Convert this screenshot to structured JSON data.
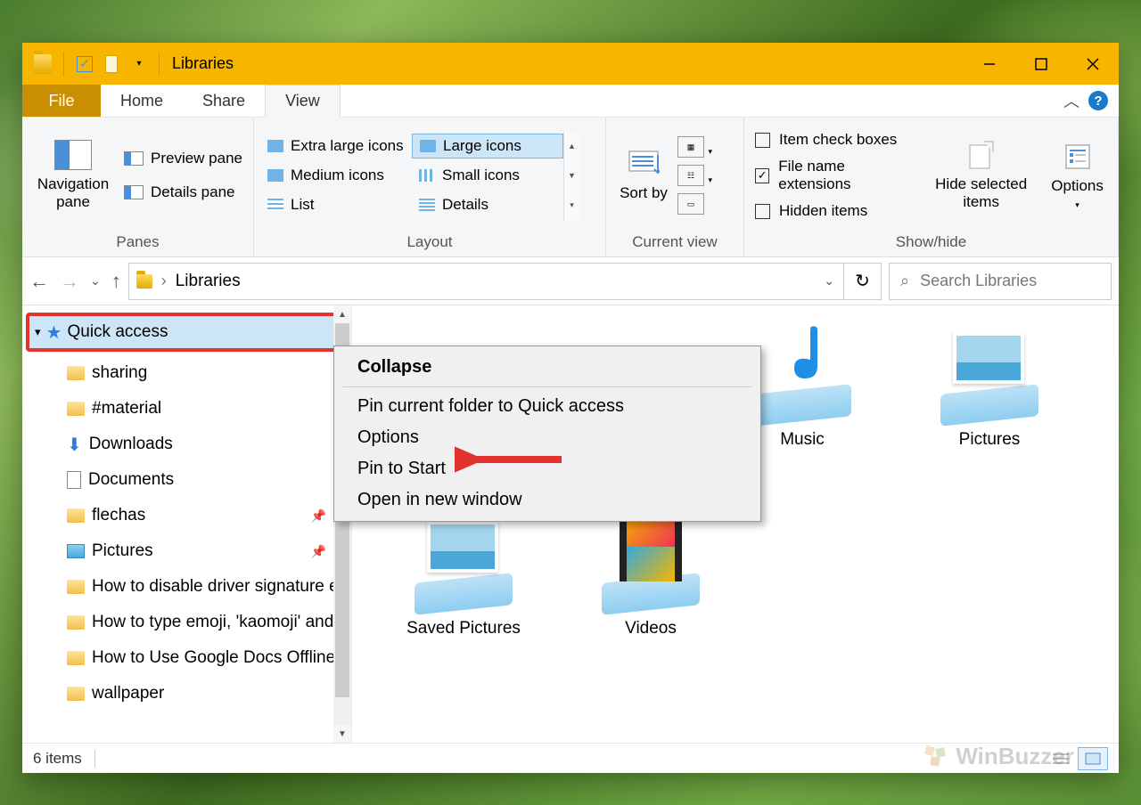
{
  "window": {
    "title": "Libraries"
  },
  "tabs": {
    "file": "File",
    "home": "Home",
    "share": "Share",
    "view": "View"
  },
  "ribbon": {
    "panes": {
      "label": "Panes",
      "navigation": "Navigation pane",
      "preview": "Preview pane",
      "details": "Details pane"
    },
    "layout": {
      "label": "Layout",
      "extra_large": "Extra large icons",
      "large": "Large icons",
      "medium": "Medium icons",
      "small": "Small icons",
      "list": "List",
      "details": "Details"
    },
    "current_view": {
      "label": "Current view",
      "sort_by": "Sort by"
    },
    "show_hide": {
      "label": "Show/hide",
      "item_check_boxes": "Item check boxes",
      "file_name_extensions": "File name extensions",
      "hidden_items": "Hidden items",
      "hide_selected": "Hide selected items",
      "options": "Options"
    }
  },
  "address": {
    "location": "Libraries"
  },
  "search": {
    "placeholder": "Search Libraries"
  },
  "sidebar": {
    "quick_access": "Quick access",
    "items": [
      {
        "label": "sharing",
        "icon": "folder"
      },
      {
        "label": "#material",
        "icon": "folder"
      },
      {
        "label": "Downloads",
        "icon": "download"
      },
      {
        "label": "Documents",
        "icon": "document"
      },
      {
        "label": "flechas",
        "icon": "folder",
        "pinned": true
      },
      {
        "label": "Pictures",
        "icon": "pictures",
        "pinned": true
      },
      {
        "label": "How to disable driver signature en",
        "icon": "folder"
      },
      {
        "label": "How to type emoji, 'kaomoji' and",
        "icon": "folder"
      },
      {
        "label": "How to Use Google Docs Offline",
        "icon": "folder"
      },
      {
        "label": "wallpaper",
        "icon": "folder"
      }
    ]
  },
  "libraries": [
    {
      "label": "Music",
      "icon": "music"
    },
    {
      "label": "Pictures",
      "icon": "pictures"
    },
    {
      "label": "Saved Pictures",
      "icon": "pictures"
    },
    {
      "label": "Videos",
      "icon": "videos"
    }
  ],
  "context_menu": {
    "collapse": "Collapse",
    "pin_quick": "Pin current folder to Quick access",
    "options": "Options",
    "pin_start": "Pin to Start",
    "open_new": "Open in new window"
  },
  "status": {
    "count": "6 items"
  },
  "watermark": "WinBuzzer"
}
